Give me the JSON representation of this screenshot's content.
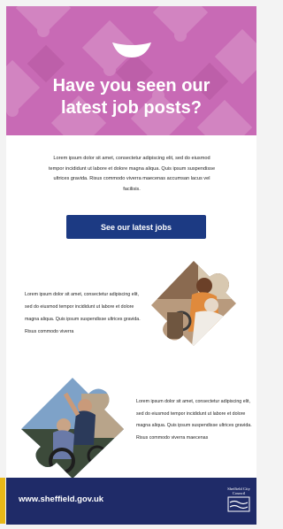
{
  "hero": {
    "title_line1": "Have you seen our",
    "title_line2": "latest job posts?",
    "background_color": "#c86ab5",
    "icon": "smile-icon"
  },
  "intro": {
    "text": "Lorem ipsum dolor sit amet, consectetur adipiscing elit, sed do eiusmod tempor incididunt ut labore et dolore magna aliqua. Quis ipsum suspendisse ultrices gravida. Risus commodo viverra maecenas accumsan lacus vel facilisis."
  },
  "cta": {
    "label": "See our latest jobs",
    "color": "#1c3a83"
  },
  "section1": {
    "text": "Lorem ipsum dolor sit amet, consectetur adipiscing elit, sed do eiusmod tempor incididunt ut labore et dolore magna aliqua. Quis ipsum suspendisse ultrices gravida. Risus commodo viverra"
  },
  "section2": {
    "text": "Lorem ipsum dolor sit amet, consectetur adipiscing elit, sed do eiusmod tempor incididunt ut labore et dolore magna aliqua. Quis ipsum suspendisse ultrices gravida. Risus commodo viverra maecenas"
  },
  "footer": {
    "url": "www.sheffield.gov.uk",
    "logo_text": "Sheffield City Council",
    "background_color": "#1f2b68"
  }
}
